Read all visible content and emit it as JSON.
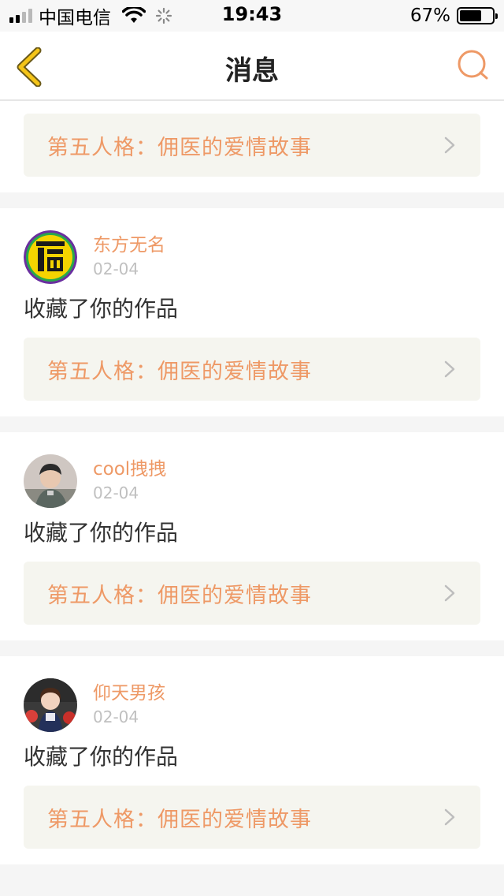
{
  "status_bar": {
    "carrier": "中国电信",
    "time": "19:43",
    "battery_percent_text": "67%",
    "battery_level": 0.67
  },
  "nav": {
    "title": "消息",
    "accent_color": "#ee9966",
    "back_icon_color": "#f5c518"
  },
  "notifications": [
    {
      "username": "",
      "date": "",
      "action": "",
      "work_title": "第五人格：佣医的爱情故事"
    },
    {
      "username": "东方无名",
      "date": "02-04",
      "action": "收藏了你的作品",
      "work_title": "第五人格：佣医的爱情故事",
      "avatar_icon": "fu-character-avatar"
    },
    {
      "username": "cool拽拽",
      "date": "02-04",
      "action": "收藏了你的作品",
      "work_title": "第五人格：佣医的爱情故事",
      "avatar_icon": "boy-photo-avatar"
    },
    {
      "username": "仰天男孩",
      "date": "02-04",
      "action": "收藏了你的作品",
      "work_title": "第五人格：佣医的爱情故事",
      "avatar_icon": "girl-photo-avatar"
    }
  ],
  "colors": {
    "username": "#ee9966",
    "work_link_bg": "#f5f5ef",
    "page_bg": "#f5f5f5"
  }
}
